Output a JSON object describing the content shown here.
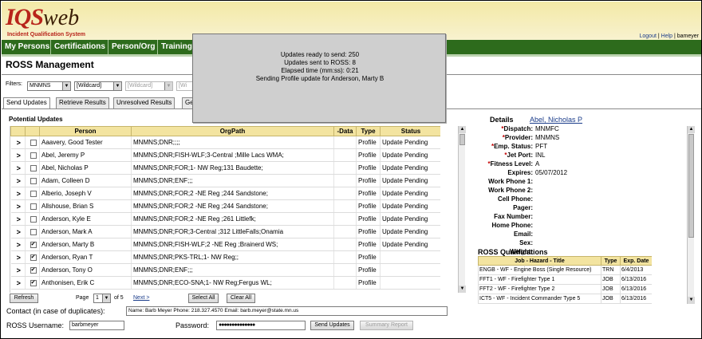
{
  "header": {
    "logo_iqs": "IQS",
    "logo_web": "web",
    "logo_subtitle": "Incident Qualification System",
    "links": {
      "logout": "Logout",
      "help": "Help",
      "user": "bameyer"
    }
  },
  "nav": {
    "items": [
      "My Persons",
      "Certifications",
      "Person/Org",
      "Training"
    ]
  },
  "page_title": "ROSS Management",
  "filters": {
    "label": "Filters:",
    "values": [
      "MNMNS",
      "[Wildcard]",
      "[Wildcard]",
      "[Wi"
    ]
  },
  "tabs": [
    "Send Updates",
    "Retrieve Results",
    "Unresolved Results",
    "Ge"
  ],
  "potential_updates": {
    "title": "Potential Updates",
    "columns": [
      "Person",
      "OrgPath",
      "-Data",
      "Type",
      "Status"
    ],
    "rows": [
      {
        "checked": false,
        "person": "Aaavery, Good Tester",
        "orgpath": "MNMNS;DNR;;;;",
        "type": "Profile",
        "status": "Update Pending"
      },
      {
        "checked": false,
        "person": "Abel, Jeremy P",
        "orgpath": "MNMNS;DNR;FISH-WLF;3-Central ;Mille Lacs WMA;",
        "type": "Profile",
        "status": "Update Pending"
      },
      {
        "checked": false,
        "person": "Abel, Nicholas P",
        "orgpath": "MNMNS;DNR;FOR;1- NW Reg;131 Baudette;",
        "type": "Profile",
        "status": "Update Pending"
      },
      {
        "checked": false,
        "person": "Adam, Colleen D",
        "orgpath": "MNMNS;DNR;ENF;;;",
        "type": "Profile",
        "status": "Update Pending"
      },
      {
        "checked": false,
        "person": "Alberio, Joseph V",
        "orgpath": "MNMNS;DNR;FOR;2 -NE Reg ;244 Sandstone;",
        "type": "Profile",
        "status": "Update Pending"
      },
      {
        "checked": false,
        "person": "Allshouse, Brian S",
        "orgpath": "MNMNS;DNR;FOR;2 -NE Reg ;244 Sandstone;",
        "type": "Profile",
        "status": "Update Pending"
      },
      {
        "checked": false,
        "person": "Anderson, Kyle E",
        "orgpath": "MNMNS;DNR;FOR;2 -NE Reg ;261 Littlefk;",
        "type": "Profile",
        "status": "Update Pending"
      },
      {
        "checked": false,
        "person": "Anderson, Mark A",
        "orgpath": "MNMNS;DNR;FOR;3-Central ;312 LittleFalls;Onamia",
        "type": "Profile",
        "status": "Update Pending"
      },
      {
        "checked": true,
        "person": "Anderson, Marty B",
        "orgpath": "MNMNS;DNR;FISH-WLF;2 -NE Reg ;Brainerd WS;",
        "type": "Profile",
        "status": "Update Pending"
      },
      {
        "checked": true,
        "person": "Anderson, Ryan T",
        "orgpath": "MNMNS;DNR;PKS-TRL;1- NW Reg;;",
        "type": "Profile",
        "status": ""
      },
      {
        "checked": true,
        "person": "Anderson, Tony O",
        "orgpath": "MNMNS;DNR;ENF;;;",
        "type": "Profile",
        "status": ""
      },
      {
        "checked": true,
        "person": "Anthonisen, Erik C",
        "orgpath": "MNMNS;DNR;ECO-SNA;1- NW Reg;Fergus WL;",
        "type": "Profile",
        "status": ""
      }
    ]
  },
  "pager": {
    "refresh": "Refresh",
    "page_label": "Page",
    "page_value": "1",
    "of_label": "of 5",
    "next": "Next >",
    "select_all": "Select All",
    "clear_all": "Clear All"
  },
  "contact": {
    "label": "Contact (in case of duplicates):",
    "value": "Name: Barb Meyer Phone: 218.327.4570 Email: barb.meyer@state.mn.us"
  },
  "login": {
    "username_label": "ROSS Username:",
    "username": "barbmeyer",
    "password_label": "Password:",
    "password": "●●●●●●●●●●●●●●",
    "send_updates": "Send Updates",
    "summary_report": "Summary Report"
  },
  "details": {
    "title": "Details",
    "name": "Abel, Nicholas P",
    "fields": [
      {
        "label": "Dispatch:",
        "required": true,
        "value": "MNMFC"
      },
      {
        "label": "Provider:",
        "required": true,
        "value": "MNMNS"
      },
      {
        "label": "Emp. Status:",
        "required": true,
        "value": "PFT"
      },
      {
        "label": "Jet Port:",
        "required": true,
        "value": "INL"
      },
      {
        "label": "Fitness Level:",
        "required": true,
        "value": "A"
      },
      {
        "label": "Expires:",
        "required": false,
        "value": "05/07/2012"
      },
      {
        "label": "Work Phone 1:",
        "required": false,
        "value": ""
      },
      {
        "label": "Work Phone 2:",
        "required": false,
        "value": ""
      },
      {
        "label": "Cell Phone:",
        "required": false,
        "value": ""
      },
      {
        "label": "Pager:",
        "required": false,
        "value": ""
      },
      {
        "label": "Fax Number:",
        "required": false,
        "value": ""
      },
      {
        "label": "Home Phone:",
        "required": false,
        "value": ""
      },
      {
        "label": "Email:",
        "required": false,
        "value": ""
      },
      {
        "label": "Sex:",
        "required": false,
        "value": ""
      },
      {
        "label": "Weight:",
        "required": false,
        "value": ""
      }
    ],
    "ross_title": "ROSS Qualifications",
    "ross_columns": [
      "Job - Hazard - Title",
      "Type",
      "Exp. Date"
    ],
    "ross_rows": [
      {
        "job": "ENGB - WF - Engine Boss (Single Resource)",
        "type": "TRN",
        "exp": "6/4/2013"
      },
      {
        "job": "FFT1 - WF - Firefighter Type 1",
        "type": "JOB",
        "exp": "6/13/2016"
      },
      {
        "job": "FFT2 - WF - Firefighter Type 2",
        "type": "JOB",
        "exp": "6/13/2016"
      },
      {
        "job": "ICT5 - WF - Incident Commander Type 5",
        "type": "JOB",
        "exp": "6/13/2016"
      }
    ]
  },
  "popup": {
    "lines": [
      "Updates ready to send: 250",
      "Updates sent to ROSS: 8",
      "Elapsed time (mm:ss): 0:21",
      "Sending Profile update for Anderson, Marty B"
    ]
  },
  "colors": {
    "nav_green": "#2d6b1c",
    "header_yellow": "#f3e9a6",
    "grid_header": "#f3e4a0",
    "logo_red": "#b8241b",
    "required_red": "#c00000"
  }
}
